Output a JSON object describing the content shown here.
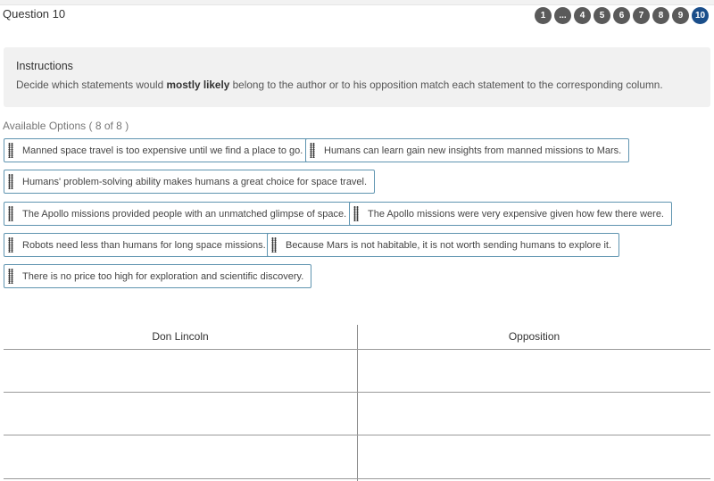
{
  "header": {
    "question_title": "Question 10",
    "pager": [
      {
        "label": "1",
        "active": false
      },
      {
        "label": "...",
        "active": false
      },
      {
        "label": "4",
        "active": false
      },
      {
        "label": "5",
        "active": false
      },
      {
        "label": "6",
        "active": false
      },
      {
        "label": "7",
        "active": false
      },
      {
        "label": "8",
        "active": false
      },
      {
        "label": "9",
        "active": false
      },
      {
        "label": "10",
        "active": true
      }
    ],
    "colors": {
      "pager_default": "#5a5a5a",
      "pager_active": "#1a4e8a"
    }
  },
  "instructions": {
    "title": "Instructions",
    "text_before": "Decide which statements would ",
    "text_bold": "mostly likely",
    "text_after": " belong to the author or to his opposition match each statement to the corresponding column."
  },
  "options": {
    "label": "Available Options ( 8 of 8 )",
    "items": [
      "Manned space travel is too expensive until we find a place to go.",
      "Humans can learn gain new insights from manned missions to Mars.",
      "Humans' problem-solving ability makes humans a great choice for space travel.",
      "The Apollo missions provided people with an unmatched glimpse of space.",
      "The Apollo missions were very expensive given how few there were.",
      "Robots need less than humans for long space missions.",
      "Because Mars is not habitable, it is not worth sending humans to explore it.",
      "There is no price too high for exploration and scientific discovery."
    ],
    "chip_border_color": "#5f94b0"
  },
  "columns": {
    "left": "Don Lincoln",
    "right": "Opposition"
  }
}
